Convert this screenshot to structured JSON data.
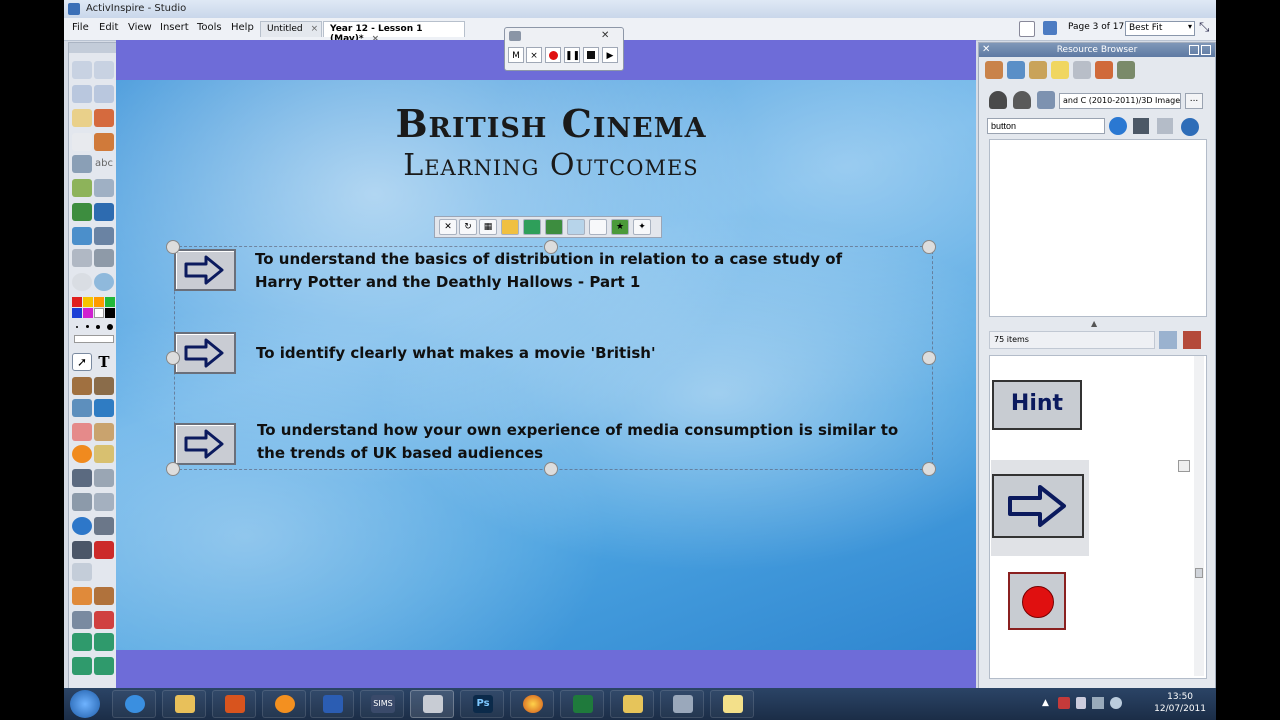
{
  "window": {
    "title": "ActivInspire - Studio"
  },
  "menu": [
    "File",
    "Edit",
    "View",
    "Insert",
    "Tools",
    "Help"
  ],
  "tabs": [
    {
      "label": "Untitled",
      "close": "×"
    },
    {
      "label": "Year 12 - Lesson 1 (May)*",
      "close": "×"
    }
  ],
  "page_nav": {
    "label": "Page 3 of 17",
    "zoom": "Best Fit"
  },
  "recorder": {
    "m": "M",
    "x": "×"
  },
  "slide": {
    "title": "British Cinema",
    "subtitle": "Learning Outcomes",
    "outcomes": [
      {
        "line1": "To understand the basics of distribution in relation to a case study of",
        "line2": "Harry Potter and the Deathly Hallows - Part 1"
      },
      {
        "line1": "To identify clearly what makes a movie 'British'",
        "line2": ""
      },
      {
        "line1": "To understand how your own experience of media consumption is similar to",
        "line2": "the trends of UK based audiences"
      }
    ]
  },
  "toolbox": {
    "text_tool": "T",
    "abc": "abc"
  },
  "resource_browser": {
    "title": "Resource Browser",
    "path": "and C (2010-2011)/3D Images",
    "more": "...",
    "search": "button",
    "items_count": "75 items",
    "gallery": {
      "hint_label": "Hint"
    }
  },
  "taskbar": {
    "sims": "SIMS",
    "ps": "Ps",
    "time": "13:50",
    "date": "12/07/2011"
  },
  "colors": {
    "canvas_band": "#6e6cd8",
    "sky": "#4aa2e0",
    "arrow_fill": "#0b1a5e"
  }
}
